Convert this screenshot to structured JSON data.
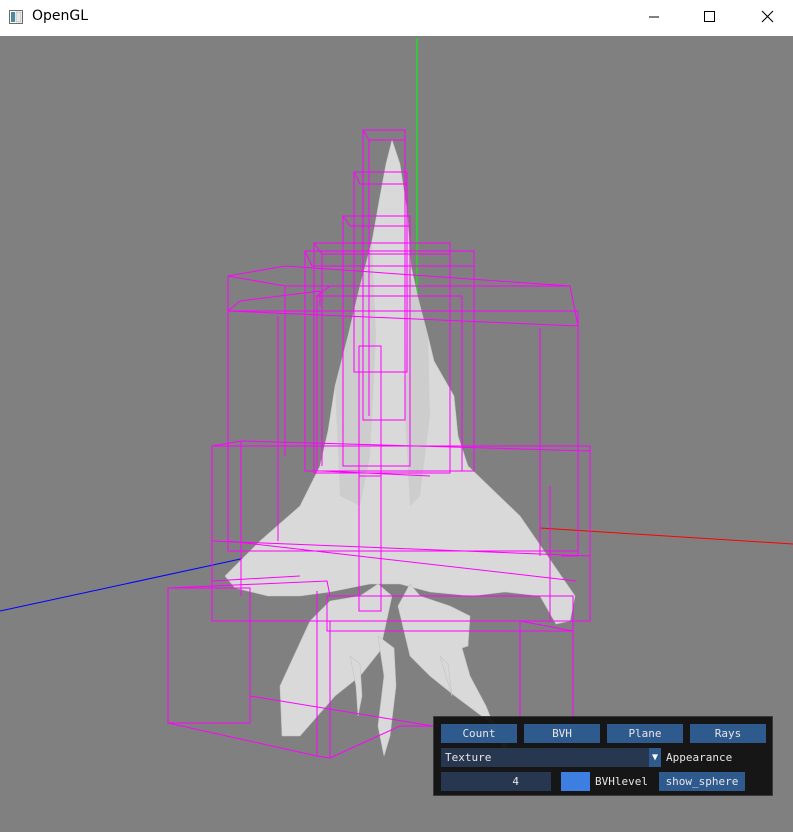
{
  "window": {
    "title": "OpenGL",
    "icon": "opengl-app-icon",
    "controls": {
      "minimize_icon": "minimize-icon",
      "maximize_icon": "maximize-icon",
      "close_icon": "close-icon"
    }
  },
  "scene": {
    "background_color": "#808080",
    "axis_colors": {
      "x": "#ff0000",
      "y": "#00ff00",
      "z": "#0000ff"
    },
    "bvh_box_color": "#ff00ff",
    "model_color": "#d8d8d8"
  },
  "panel": {
    "buttons": [
      "Count",
      "BVH",
      "Plane",
      "Rays"
    ],
    "appearance_combo": {
      "value": "Texture",
      "label": "Appearance"
    },
    "bvh_level": {
      "value": "4",
      "label": "BVHlevel"
    },
    "color_swatch": "#3d7fe0",
    "show_sphere_label": "show_sphere"
  }
}
